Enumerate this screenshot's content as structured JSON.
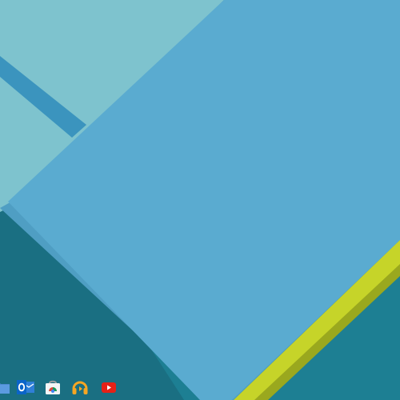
{
  "wallpaper": {
    "name": "material-geometric-wallpaper",
    "colors": {
      "deep_teal": "#1d7f93",
      "dark_teal": "#1a6f82",
      "light_cyan": "#7ec3ce",
      "sky_blue": "#5aabd0",
      "stripe_blue": "#3b94be",
      "yellow_band": "#c6d429",
      "yellow_shadow": "#9aa81e"
    }
  },
  "shelf": {
    "items": [
      {
        "name": "files-app",
        "icon": "folder-icon",
        "color": "#4c8ad1"
      },
      {
        "name": "outlook-app",
        "icon": "outlook-icon",
        "color": "#0a64c8"
      },
      {
        "name": "chrome-web-store-app",
        "icon": "web-store-icon",
        "color": "#ffffff"
      },
      {
        "name": "play-music-app",
        "icon": "headphones-icon",
        "color": "#f6a623"
      },
      {
        "name": "youtube-app",
        "icon": "youtube-icon",
        "color": "#e62117"
      }
    ]
  }
}
